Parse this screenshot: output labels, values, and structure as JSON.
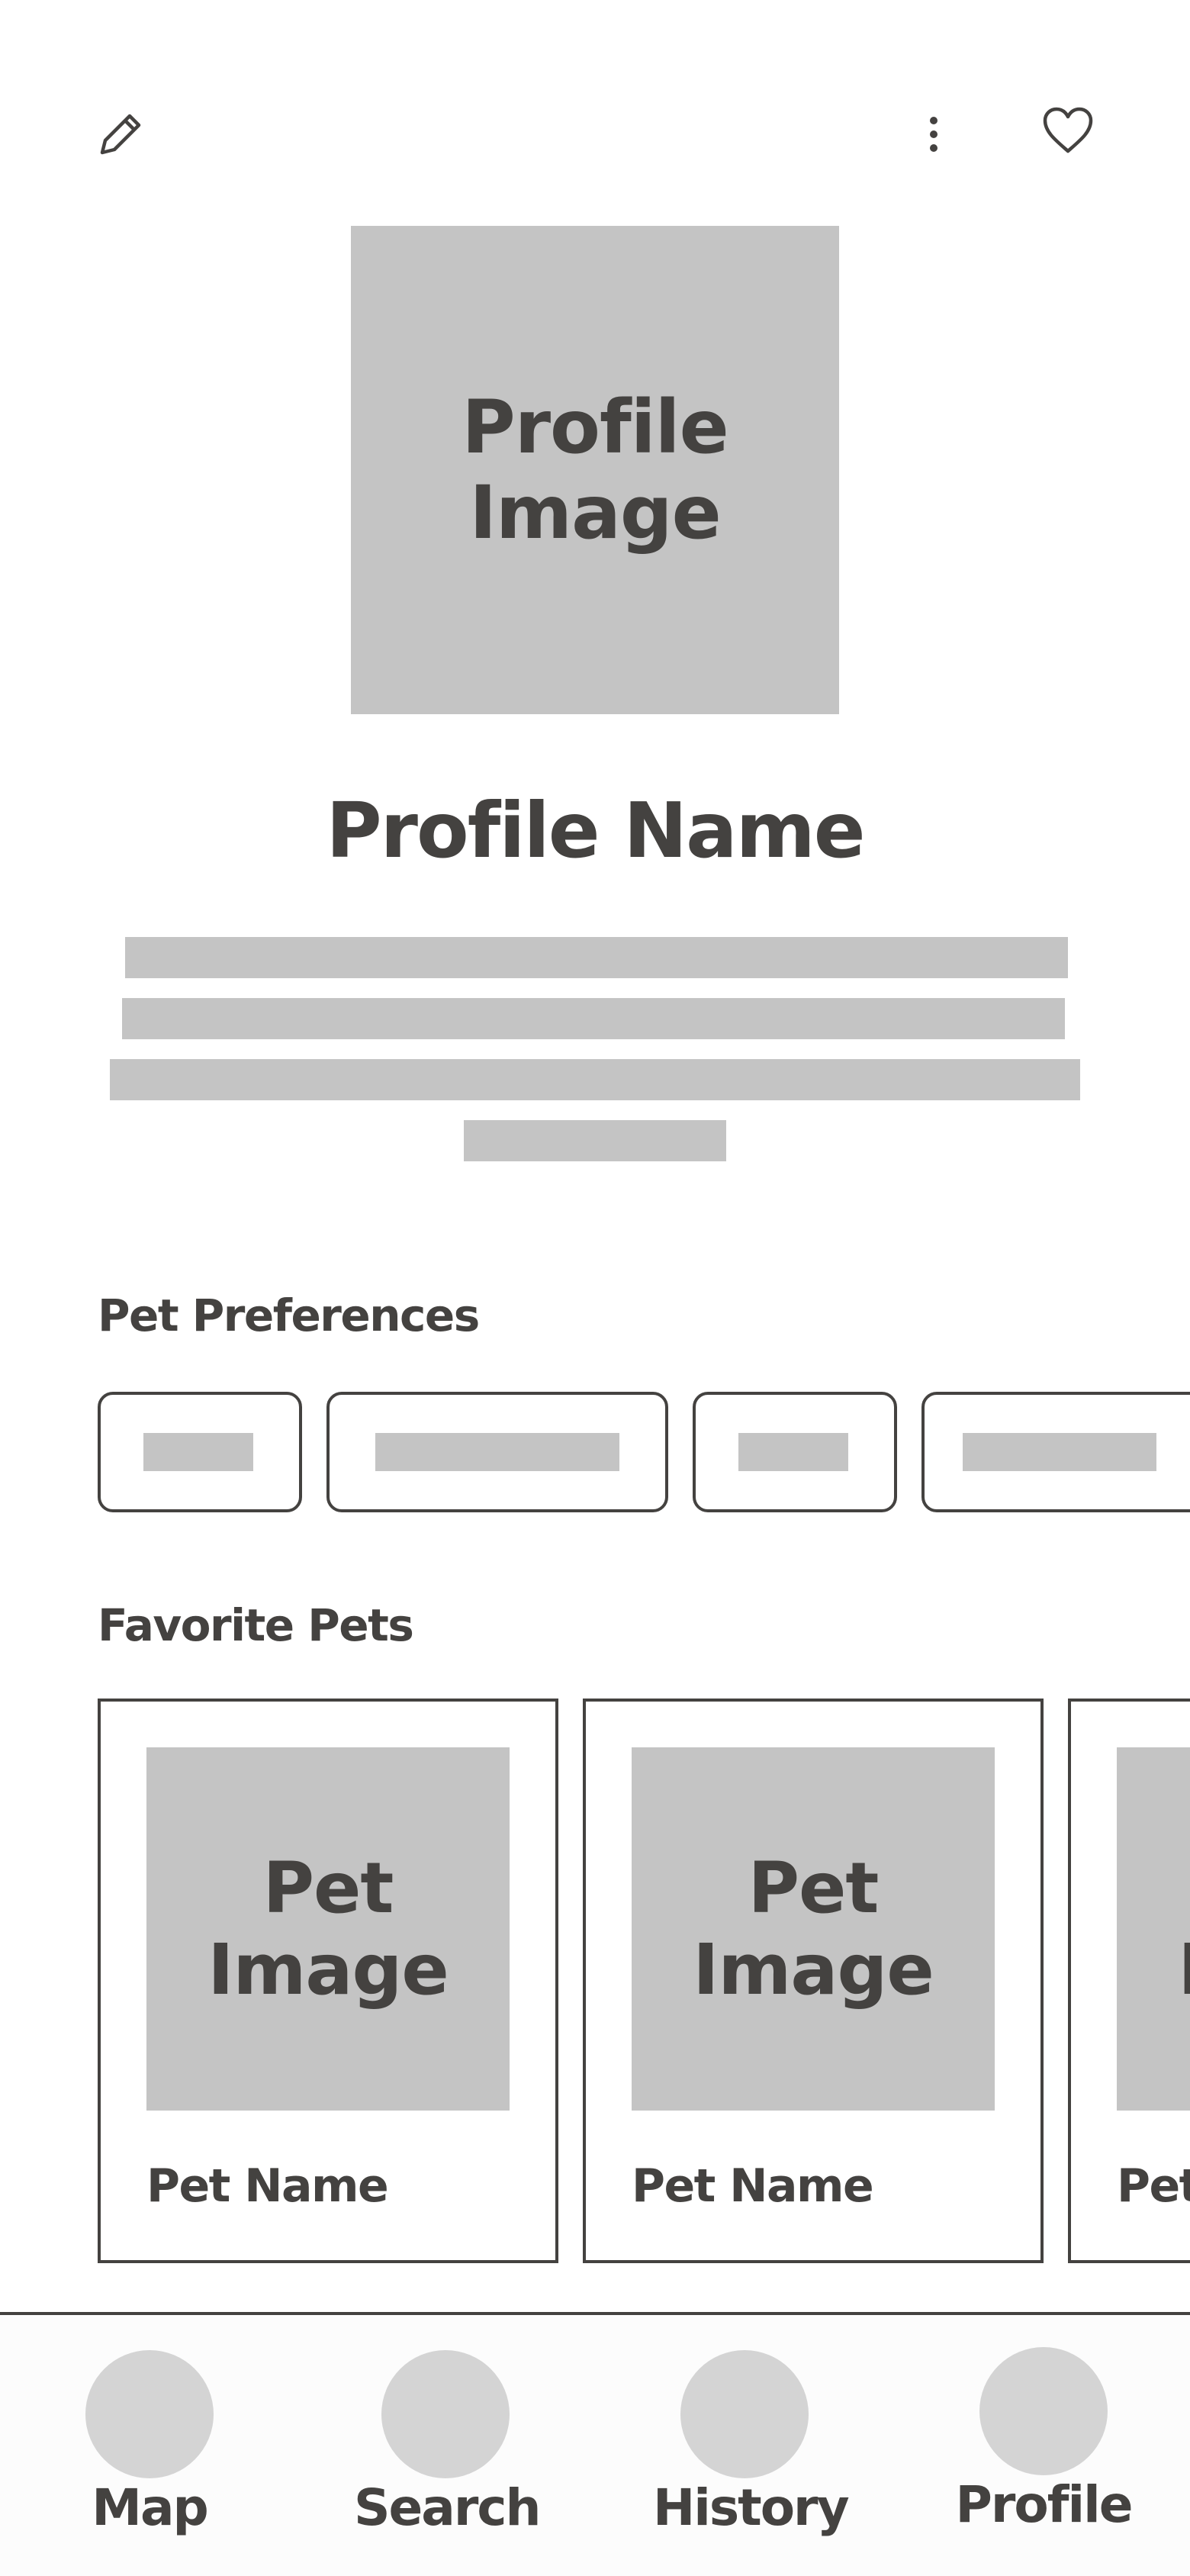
{
  "header": {
    "edit_icon": "pencil-icon",
    "more_icon": "more-vertical-icon",
    "favorite_icon": "heart-icon"
  },
  "profile": {
    "image_label": "Profile Image",
    "name": "Profile Name"
  },
  "pet_preferences": {
    "title": "Pet Preferences",
    "chip_count": 4
  },
  "favorite_pets": {
    "title": "Favorite Pets",
    "cards": [
      {
        "image_label": "Pet Image",
        "name": "Pet Name"
      },
      {
        "image_label": "Pet Image",
        "name": "Pet Name"
      },
      {
        "image_label": "Pet Image",
        "name": "Pet Name"
      }
    ]
  },
  "nav": {
    "items": [
      {
        "label": "Map"
      },
      {
        "label": "Search"
      },
      {
        "label": "History"
      },
      {
        "label": "Profile"
      }
    ]
  },
  "colors": {
    "ink": "#444240",
    "placeholder": "#c4c4c4",
    "nav_circle": "#d4d4d4",
    "background": "#ffffff"
  }
}
